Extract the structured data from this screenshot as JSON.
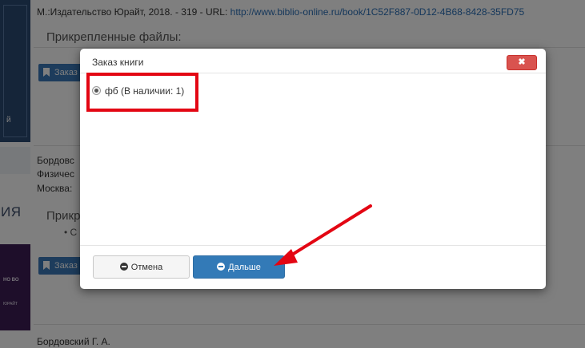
{
  "background": {
    "cover1_text": "й",
    "cover2_big_text": "ИЯ",
    "cover2_badge_line1": "НО ВО",
    "cover2_badge_line2": "ЮРАЙТ",
    "citation1_prefix": "М.:Издательство Юрайт, 2018. - 319 - URL: ",
    "citation1_link": "http://www.biblio-online.ru/book/1C52F887-0D12-4B68-8428-35FD75",
    "attached_files_label1": "Прикрепленные файлы:",
    "order_button1": "Заказ",
    "author2": "Бордовс",
    "title2": "Физичес",
    "publisher2": "Москва:",
    "attached_files_label2": "Прикр",
    "bullet": "•  С",
    "order_button2": "Заказ",
    "author3": "Бордовский Г. А."
  },
  "modal": {
    "title": "Заказ книги",
    "close_label": "✖",
    "option_label": "фб (В наличии: 1)",
    "option_selected": true,
    "cancel_label": "Отмена",
    "next_label": "Дальше"
  },
  "colors": {
    "highlight": "#e30613",
    "primary": "#337ab7",
    "danger": "#d9534f"
  }
}
